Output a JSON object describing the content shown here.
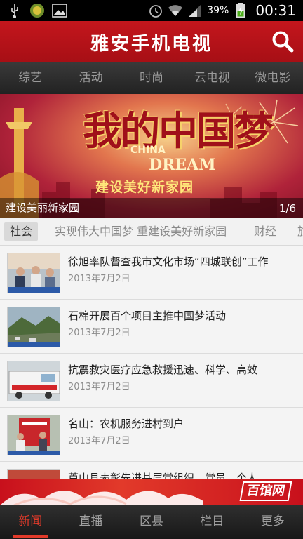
{
  "status_bar": {
    "icons": [
      "usb-icon",
      "app-badge-icon",
      "image-icon",
      "alarm-icon",
      "wifi-icon",
      "signal-icon",
      "battery-charging-icon"
    ],
    "battery_percent": "39%",
    "time": "00:31"
  },
  "header": {
    "title": "雅安手机电视",
    "search_icon": "search-icon",
    "color": "#c4161d"
  },
  "category_tabs": [
    "综艺",
    "活动",
    "时尚",
    "云电视",
    "微电影"
  ],
  "banner": {
    "headline": "我的中国梦",
    "english_1": "CHINA",
    "english_2": "DREAM",
    "subtitle": "建设美好新家园",
    "caption": "建设美丽新家园",
    "counter": "1/6"
  },
  "tag_bar": [
    "社会",
    "实现伟大中国梦 重建设美好新家园",
    "财经",
    "旅"
  ],
  "news_list": [
    {
      "title": "徐旭率队督查我市文化市场“四城联创”工作",
      "date": "2013年7月2日"
    },
    {
      "title": "石棉开展百个项目主推中国梦活动",
      "date": "2013年7月2日"
    },
    {
      "title": "抗震救灾医疗应急救援迅速、科学、高效",
      "date": "2013年7月2日"
    },
    {
      "title": "名山：农机服务进村到户",
      "date": "2013年7月2日"
    },
    {
      "title": "芦山县表彰先进基层党组织、党员、个人",
      "date": ""
    }
  ],
  "promo": {
    "label": "百馆网"
  },
  "bottom_nav": [
    "新闻",
    "直播",
    "区县",
    "栏目",
    "更多"
  ],
  "colors": {
    "accent": "#e23a2a",
    "brand_red": "#c4161d"
  }
}
